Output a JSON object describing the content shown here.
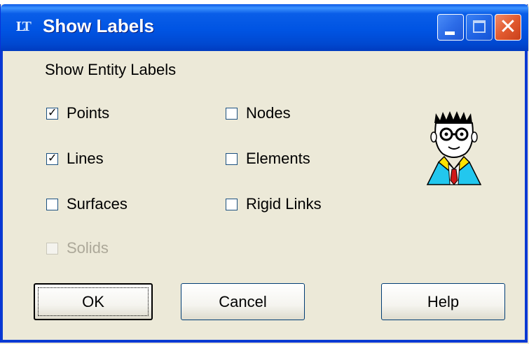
{
  "window": {
    "title": "Show Labels",
    "app_icon": "app-logo-icon",
    "controls": [
      "minimize-icon",
      "maximize-icon",
      "close-icon"
    ]
  },
  "group": {
    "label": "Show Entity Labels"
  },
  "checkboxes": [
    {
      "label": "Points",
      "checked": true,
      "enabled": true
    },
    {
      "label": "Lines",
      "checked": true,
      "enabled": true
    },
    {
      "label": "Surfaces",
      "checked": false,
      "enabled": true
    },
    {
      "label": "Solids",
      "checked": false,
      "enabled": false
    },
    {
      "label": "Nodes",
      "checked": false,
      "enabled": true
    },
    {
      "label": "Elements",
      "checked": false,
      "enabled": true
    },
    {
      "label": "Rigid Links",
      "checked": false,
      "enabled": true
    }
  ],
  "buttons": {
    "ok": "OK",
    "cancel": "Cancel",
    "help": "Help"
  },
  "colors": {
    "titlebar": "#0054e3",
    "dialog_bg": "#ece9d8",
    "close_button": "#e25a2f"
  }
}
